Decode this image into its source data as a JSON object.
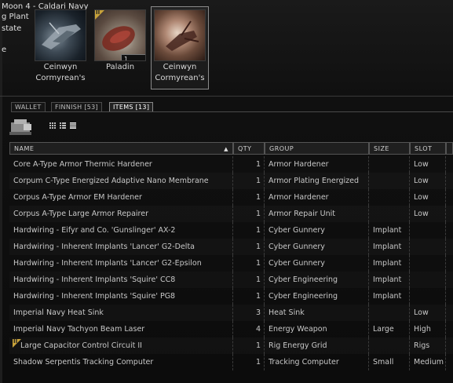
{
  "top_info": {
    "line1": "Moon 4 - Caldari Navy",
    "line2": "g Plant",
    "line3": "state",
    "line4": "e"
  },
  "ships": [
    {
      "name": "Ceinwyn Cormyrean's",
      "selected": false
    },
    {
      "name": "Paladin",
      "qty": "1",
      "tech_badge": "II",
      "selected": false
    },
    {
      "name": "Ceinwyn Cormyrean's",
      "selected": true
    }
  ],
  "tabs": [
    {
      "label": "WALLET"
    },
    {
      "label": "FINNISH [53]"
    },
    {
      "label": "ITEMS [13]",
      "active": true
    }
  ],
  "table": {
    "columns": [
      "NAME",
      "QTY",
      "GROUP",
      "SIZE",
      "SLOT"
    ],
    "sort_column": "NAME",
    "sort_glyph": "▲",
    "rows": [
      {
        "name": "Core A-Type Armor Thermic Hardener",
        "qty": "1",
        "group": "Armor Hardener",
        "size": "",
        "slot": "Low"
      },
      {
        "name": "Corpum C-Type Energized Adaptive Nano Membrane",
        "qty": "1",
        "group": "Armor Plating Energized",
        "size": "",
        "slot": "Low"
      },
      {
        "name": "Corpus A-Type Armor EM Hardener",
        "qty": "1",
        "group": "Armor Hardener",
        "size": "",
        "slot": "Low"
      },
      {
        "name": "Corpus A-Type Large Armor Repairer",
        "qty": "1",
        "group": "Armor Repair Unit",
        "size": "",
        "slot": "Low"
      },
      {
        "name": "Hardwiring - Eifyr and Co. 'Gunslinger' AX-2",
        "qty": "1",
        "group": "Cyber Gunnery",
        "size": "Implant",
        "slot": ""
      },
      {
        "name": "Hardwiring - Inherent Implants 'Lancer' G2-Delta",
        "qty": "1",
        "group": "Cyber Gunnery",
        "size": "Implant",
        "slot": ""
      },
      {
        "name": "Hardwiring - Inherent Implants 'Lancer' G2-Epsilon",
        "qty": "1",
        "group": "Cyber Gunnery",
        "size": "Implant",
        "slot": ""
      },
      {
        "name": "Hardwiring - Inherent Implants 'Squire' CC8",
        "qty": "1",
        "group": "Cyber Engineering",
        "size": "Implant",
        "slot": ""
      },
      {
        "name": "Hardwiring - Inherent Implants 'Squire' PG8",
        "qty": "1",
        "group": "Cyber Engineering",
        "size": "Implant",
        "slot": ""
      },
      {
        "name": "Imperial Navy Heat Sink",
        "qty": "3",
        "group": "Heat Sink",
        "size": "",
        "slot": "Low"
      },
      {
        "name": "Imperial Navy Tachyon Beam Laser",
        "qty": "4",
        "group": "Energy Weapon",
        "size": "Large",
        "slot": "High"
      },
      {
        "name": "Large Capacitor Control Circuit II",
        "qty": "1",
        "group": "Rig Energy Grid",
        "size": "",
        "slot": "Rigs",
        "tech_badge": "II"
      },
      {
        "name": "Shadow Serpentis Tracking Computer",
        "qty": "1",
        "group": "Tracking Computer",
        "size": "Small",
        "slot": "Medium"
      }
    ]
  },
  "colors": {
    "tech2_badge": "#c8a23a",
    "background": "#0d0d0d",
    "text": "#c8c8c8"
  }
}
